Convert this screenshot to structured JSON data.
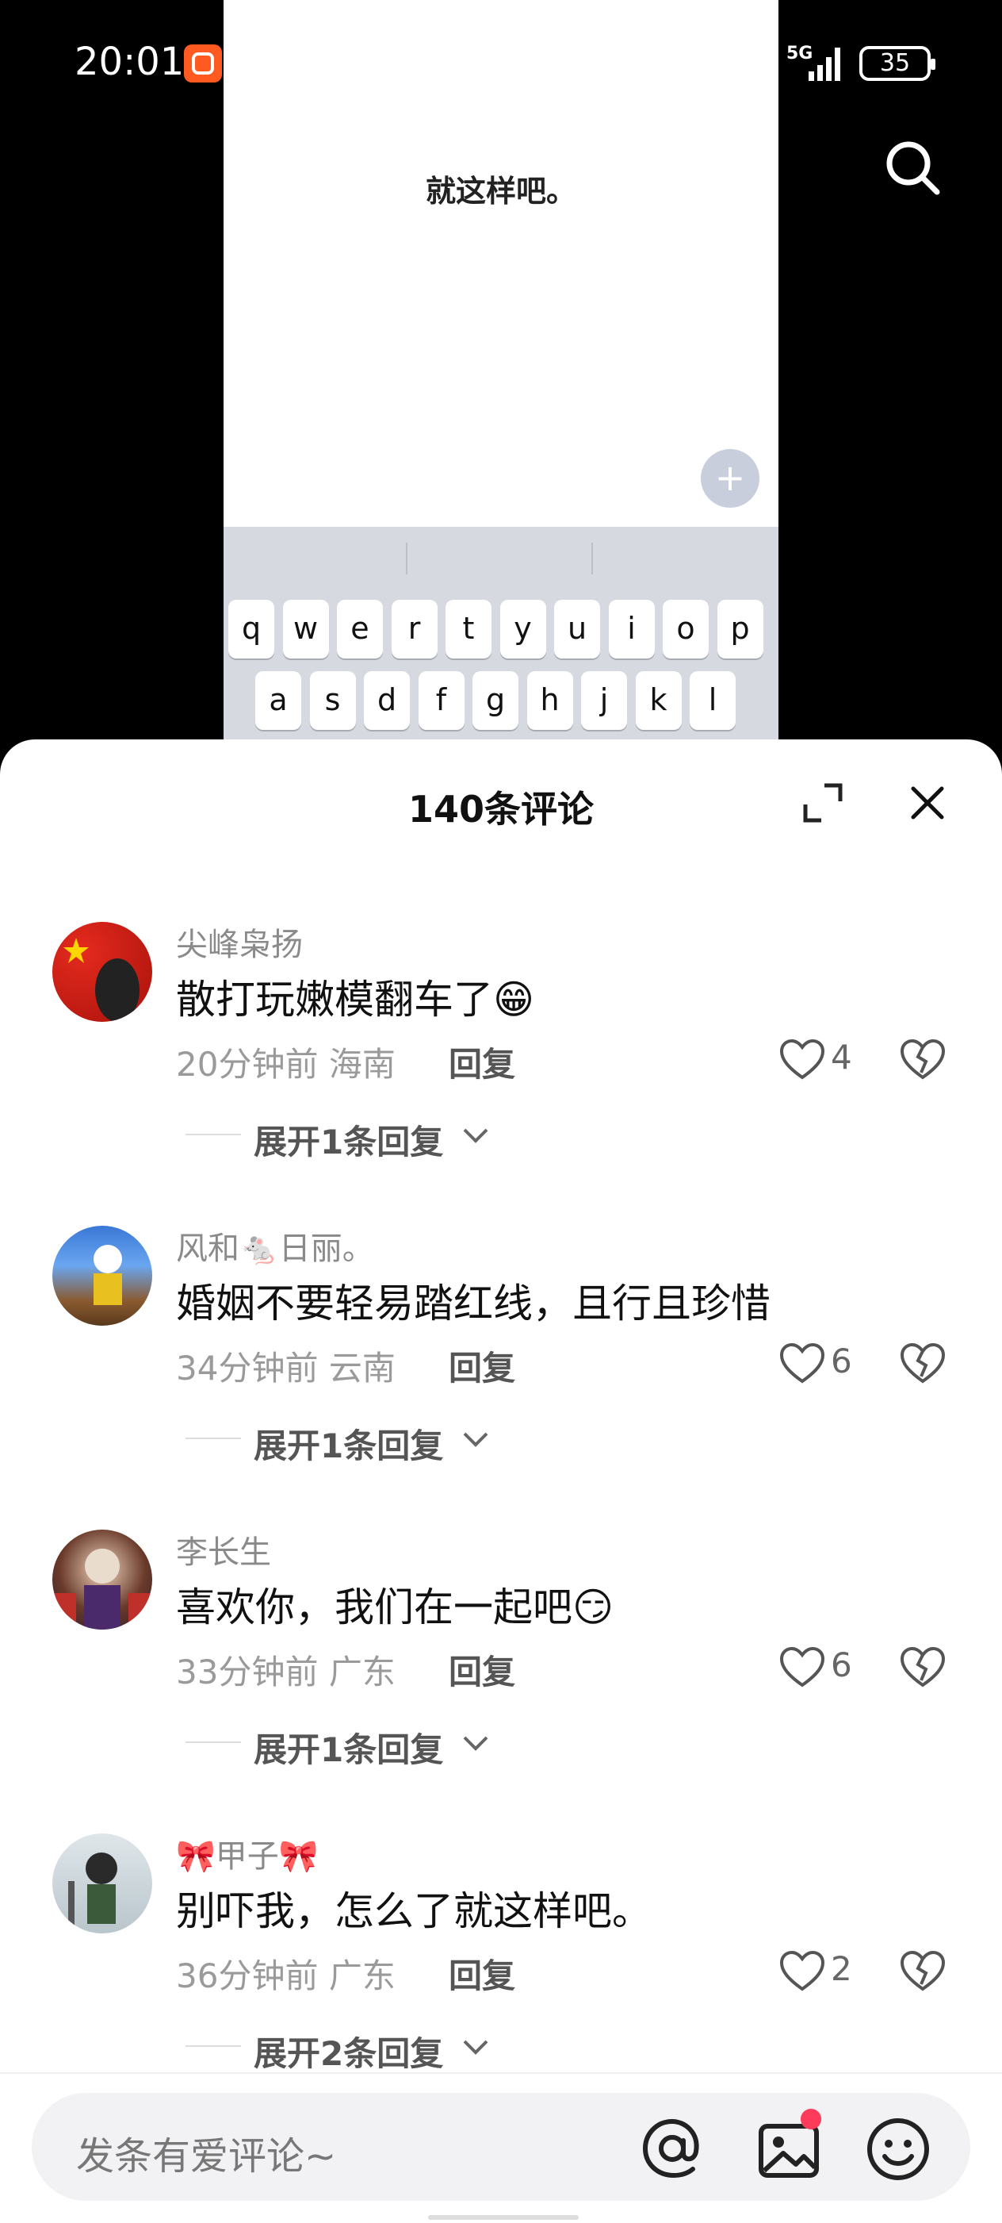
{
  "status_bar": {
    "time": "20:01",
    "network": "5G",
    "battery": "35"
  },
  "preview": {
    "text": "就这样吧。",
    "plus": "+"
  },
  "keyboard": {
    "row1": [
      "q",
      "w",
      "e",
      "r",
      "t",
      "y",
      "u",
      "i",
      "o",
      "p"
    ],
    "row2": [
      "a",
      "s",
      "d",
      "f",
      "g",
      "h",
      "j",
      "k",
      "l"
    ]
  },
  "sheet": {
    "title": "140条评论"
  },
  "comments": [
    {
      "user": "尖峰枭扬",
      "text": "散打玩嫩模翻车了😁",
      "time": "20分钟前",
      "location": "海南",
      "reply": "回复",
      "likes": "4",
      "expand": "展开1条回复"
    },
    {
      "user": "风和🐁日丽。",
      "text": "婚姻不要轻易踏红线，且行且珍惜",
      "time": "34分钟前",
      "location": "云南",
      "reply": "回复",
      "likes": "6",
      "expand": "展开1条回复"
    },
    {
      "user": "李长生",
      "text": "喜欢你，我们在一起吧😏",
      "time": "33分钟前",
      "location": "广东",
      "reply": "回复",
      "likes": "6",
      "expand": "展开1条回复"
    },
    {
      "user": "🎀甲子🎀",
      "text": "别吓我，怎么了就这样吧。",
      "time": "36分钟前",
      "location": "广东",
      "reply": "回复",
      "likes": "2",
      "expand": "展开2条回复"
    }
  ],
  "input": {
    "placeholder": "发条有爱评论~"
  },
  "icons": [
    "app-icon",
    "weibo-icon",
    "signal-icon",
    "battery-icon",
    "search-icon",
    "plus-icon",
    "expand-icon",
    "close-icon",
    "heart-icon",
    "broken-heart-icon",
    "chevron-down-icon",
    "at-icon",
    "image-icon",
    "emoji-icon"
  ]
}
